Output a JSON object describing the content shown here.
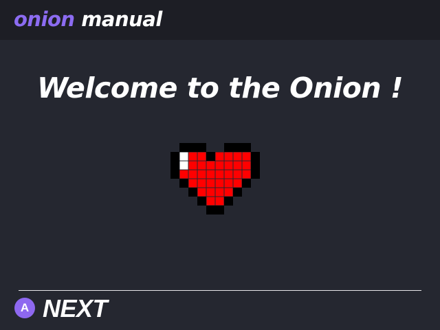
{
  "header": {
    "title_brand": "onion",
    "title_rest": "manual"
  },
  "main": {
    "heading": "Welcome to the Onion !",
    "image": "pixel-heart-icon"
  },
  "footer": {
    "button_key": "A",
    "next_label": "NEXT"
  },
  "colors": {
    "background": "#252730",
    "header_background": "#1d1e25",
    "accent": "#8c6cf2",
    "heart_red": "#ff0000",
    "heart_outline": "#000000",
    "heart_highlight": "#ffffff"
  }
}
